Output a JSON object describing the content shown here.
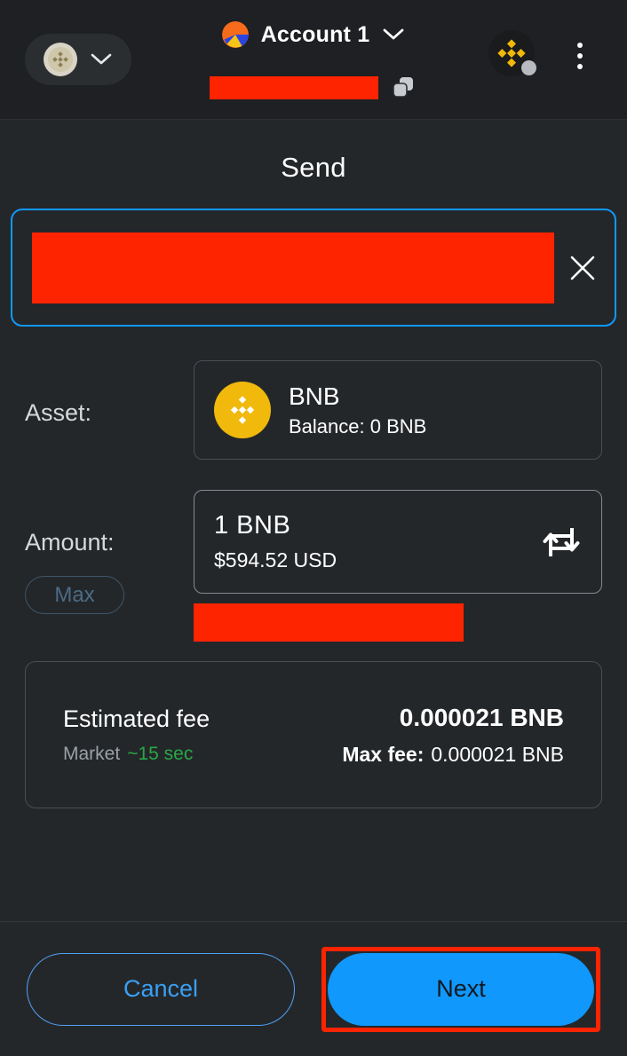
{
  "header": {
    "network_selector": {
      "icon": "bnb-network-icon",
      "chevron": "chevron-down-icon"
    },
    "account": {
      "avatar": "account-identicon",
      "name": "Account 1",
      "chevron": "chevron-down-icon",
      "address_redacted": true,
      "copy_icon": "copy-icon"
    },
    "chain_badge": {
      "icon": "binance-smart-chain-icon",
      "status": "connected"
    },
    "menu_icon": "kebab-menu-icon"
  },
  "main": {
    "title": "Send",
    "recipient": {
      "value_redacted": true,
      "clear_icon": "close-icon",
      "focused": true
    },
    "asset": {
      "label": "Asset:",
      "coin_icon": "bnb-coin-icon",
      "symbol": "BNB",
      "balance_label": "Balance:",
      "balance_value": "0 BNB",
      "balance_line": "Balance:  0 BNB"
    },
    "amount": {
      "label": "Amount:",
      "max_label": "Max",
      "max_enabled": false,
      "value": "1  BNB",
      "fiat": "$594.52 USD",
      "swap_icon": "swap-currency-icon",
      "warning_redacted": true
    },
    "fee": {
      "title": "Estimated fee",
      "market_label": "Market",
      "speed": "~15 sec",
      "amount": "0.000021 BNB",
      "max_fee_label": "Max fee:",
      "max_fee_value": "0.000021 BNB"
    }
  },
  "footer": {
    "cancel_label": "Cancel",
    "next_label": "Next",
    "next_highlighted": true
  },
  "colors": {
    "background": "#24272a",
    "header_background": "#1e2023",
    "accent_blue": "#1098fc",
    "bnb_yellow": "#f0b90b",
    "redaction_red": "#fe2400",
    "speed_green": "#28a745"
  }
}
